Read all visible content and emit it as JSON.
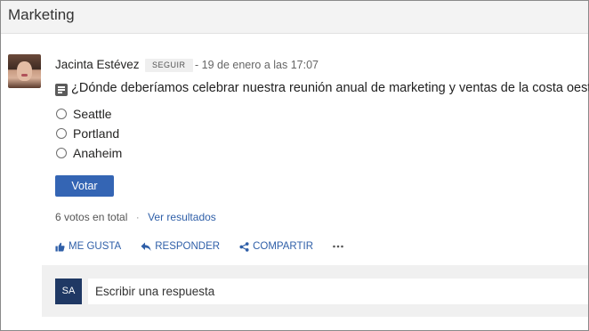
{
  "group": {
    "title": "Marketing"
  },
  "post": {
    "author": "Jacinta Estévez",
    "follow_label": "SEGUIR",
    "timestamp": "- 19 de enero a las 17:07",
    "question": "¿Dónde deberíamos celebrar nuestra reunión anual de marketing y ventas de la costa oeste?",
    "options": [
      "Seattle",
      "Portland",
      "Anaheim"
    ],
    "vote_button": "Votar",
    "votes_total": "6 votos en total",
    "separator": "·",
    "results_link": "Ver resultados",
    "actions": {
      "like": "ME GUSTA",
      "reply": "RESPONDER",
      "share": "COMPARTIR"
    }
  },
  "reply": {
    "avatar_initials": "SA",
    "placeholder": "Escribir una respuesta"
  },
  "icons": {
    "poll": "poll-icon",
    "like": "thumbs-up-icon",
    "reply": "reply-arrow-icon",
    "share": "share-icon",
    "more": "more-ellipsis-icon"
  },
  "colors": {
    "accent": "#3465b4",
    "link": "#2f5fa8",
    "user_avatar": "#1f3864"
  }
}
